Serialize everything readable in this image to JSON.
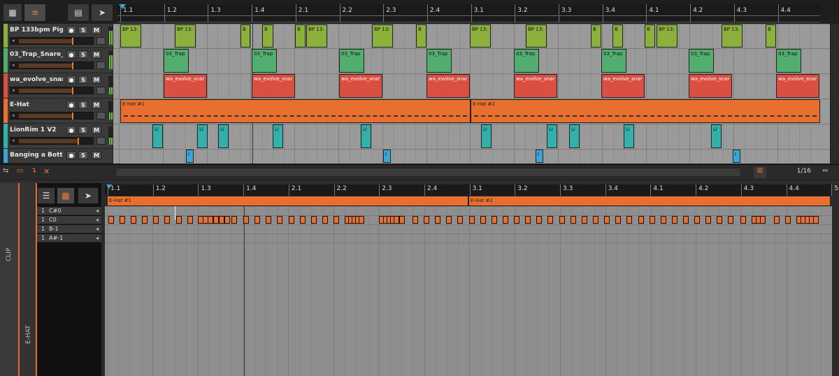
{
  "toolbar": {
    "grid_label": "1/16"
  },
  "ruler": {
    "bars": [
      "1.1",
      "1.2",
      "1.3",
      "1.4",
      "2.1",
      "2.2",
      "2.3",
      "2.4",
      "3.1",
      "3.2",
      "3.3",
      "3.4",
      "4.1",
      "4.2",
      "4.3",
      "4.4"
    ]
  },
  "tracks": [
    {
      "name": "BP 133bpm Pig F...",
      "color": "#8bb13c",
      "solo": "S",
      "mute": "M",
      "clip_label": "BP 13:"
    },
    {
      "name": "03_Trap_Snare_...",
      "color": "#52ae6f",
      "solo": "S",
      "mute": "M",
      "clip_label": "03_Trap"
    },
    {
      "name": "wa_evolve_snar...",
      "color": "#db4f42",
      "solo": "S",
      "mute": "M",
      "clip_label": "wa_evolve_snar"
    },
    {
      "name": "E-Hat",
      "color": "#e86f2d",
      "solo": "S",
      "mute": "M",
      "clip_label": "E-Hat #1"
    },
    {
      "name": "LionRim 1 V2",
      "color": "#33b0aa",
      "solo": "S",
      "mute": "M",
      "clip_label": "Li"
    },
    {
      "name": "Banging a Bottle...",
      "color": "#3aa6d8",
      "solo": "S",
      "mute": "M",
      "clip_label": "I"
    }
  ],
  "clips": {
    "ehat1": "E-Hat #1",
    "ehat2": "E-Hat #2",
    "green_short": "B",
    "green_mid": "BP 13:"
  },
  "editor": {
    "side_label": "CLIP",
    "track_label": "E-HAT",
    "keys": [
      {
        "num": "1",
        "note": "C#0"
      },
      {
        "num": "1",
        "note": "C0"
      },
      {
        "num": "1",
        "note": "B-1"
      },
      {
        "num": "1",
        "note": "A#-1"
      }
    ],
    "ruler": [
      "1.1",
      "1.2",
      "1.3",
      "1.4",
      "2.1",
      "2.2",
      "2.3",
      "2.4",
      "3.1",
      "3.2",
      "3.3",
      "3.4",
      "4.1",
      "4.2",
      "4.3",
      "4.4",
      "5."
    ],
    "clip1": "E-Hat #1",
    "clip2": "E-Hat #2"
  },
  "icons": {
    "grid": "grid-icon",
    "list": "list-icon",
    "pointer": "pointer-icon",
    "speaker": "speaker-icon"
  }
}
